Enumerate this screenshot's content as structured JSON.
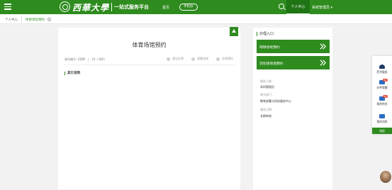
{
  "header": {
    "logo_text": "西華大學",
    "logo_subtitle": "一站式服务平台",
    "nav_home": "首页",
    "nav_app": "手机办",
    "nav_personal": "个人中心",
    "nav_manage": "系统管理员 ▾"
  },
  "breadcrumb": {
    "items": [
      "个人中心",
      "体育场馆预约"
    ],
    "close_glyph": "×"
  },
  "main": {
    "title": "体育场馆预约",
    "meta_label": "事项编号:",
    "meta_id": "1329",
    "meta_count_label": "18 人预约",
    "actions": [
      "意见反馈",
      "我要咨询",
      "在线预约"
    ],
    "section_title": "其它说明"
  },
  "side": {
    "title": "办理入口",
    "entries": [
      "网球场地预约",
      "羽毛球场地预约"
    ],
    "info": [
      {
        "label": "服务人群：",
        "value": "本科管理员"
      },
      {
        "label": "牵头部门：",
        "value": "教育部署与科技服务中心"
      },
      {
        "label": "服务日期：",
        "value": "长期有效"
      }
    ]
  },
  "dock": {
    "items": [
      {
        "label": "西华服务",
        "badge": ""
      },
      {
        "label": "办件提醒",
        "badge": "10"
      },
      {
        "label": "我的待办",
        "badge": "10"
      },
      {
        "label": "我的消息",
        "badge": ""
      }
    ],
    "footer": "收起"
  },
  "colors": {
    "brand_green": "#2e8b1e",
    "active_green": "#1f7414",
    "badge_red": "#e84b3c"
  }
}
